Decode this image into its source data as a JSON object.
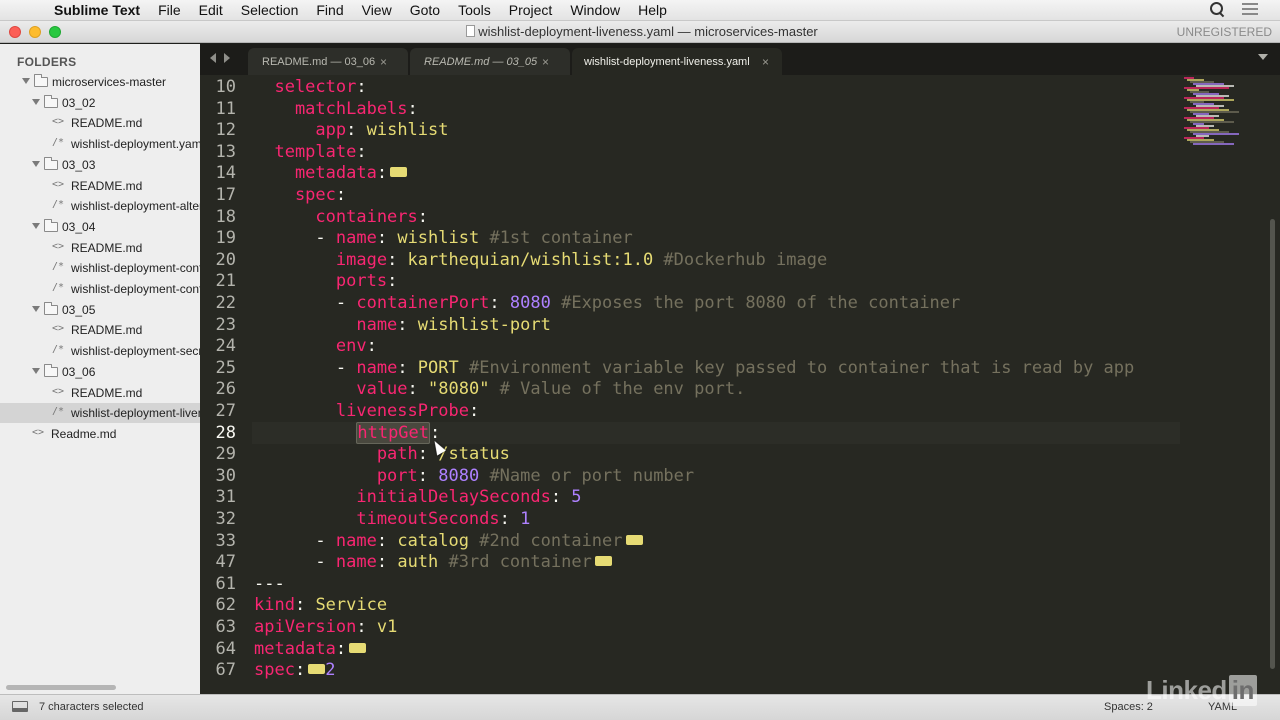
{
  "menubar": {
    "app_name": "Sublime Text",
    "items": [
      "File",
      "Edit",
      "Selection",
      "Find",
      "View",
      "Goto",
      "Tools",
      "Project",
      "Window",
      "Help"
    ]
  },
  "window": {
    "title": "wishlist-deployment-liveness.yaml — microservices-master",
    "registration": "UNREGISTERED"
  },
  "sidebar": {
    "header": "FOLDERS",
    "tree": [
      {
        "label": "microservices-master",
        "kind": "folder",
        "depth": 0
      },
      {
        "label": "03_02",
        "kind": "folder",
        "depth": 1
      },
      {
        "label": "README.md",
        "kind": "file",
        "icon": "<>",
        "depth": 2
      },
      {
        "label": "wishlist-deployment.yaml",
        "kind": "file",
        "icon": "/*",
        "depth": 2
      },
      {
        "label": "03_03",
        "kind": "folder",
        "depth": 1
      },
      {
        "label": "README.md",
        "kind": "file",
        "icon": "<>",
        "depth": 2
      },
      {
        "label": "wishlist-deployment-alternate.yaml",
        "kind": "file",
        "icon": "/*",
        "depth": 2
      },
      {
        "label": "03_04",
        "kind": "folder",
        "depth": 1
      },
      {
        "label": "README.md",
        "kind": "file",
        "icon": "<>",
        "depth": 2
      },
      {
        "label": "wishlist-deployment-configmap.yaml",
        "kind": "file",
        "icon": "/*",
        "depth": 2
      },
      {
        "label": "wishlist-deployment-configmap-advanced.yaml",
        "kind": "file",
        "icon": "/*",
        "depth": 2
      },
      {
        "label": "03_05",
        "kind": "folder",
        "depth": 1
      },
      {
        "label": "README.md",
        "kind": "file",
        "icon": "<>",
        "depth": 2
      },
      {
        "label": "wishlist-deployment-secret.yaml",
        "kind": "file",
        "icon": "/*",
        "depth": 2
      },
      {
        "label": "03_06",
        "kind": "folder",
        "depth": 1
      },
      {
        "label": "README.md",
        "kind": "file",
        "icon": "<>",
        "depth": 2
      },
      {
        "label": "wishlist-deployment-liveness.yaml",
        "kind": "file",
        "icon": "/*",
        "depth": 2,
        "selected": true
      },
      {
        "label": "Readme.md",
        "kind": "file",
        "icon": "<>",
        "depth": 1
      }
    ]
  },
  "tabs": [
    {
      "label": "README.md — 03_06",
      "active": false,
      "italic": false
    },
    {
      "label": "README.md — 03_05",
      "active": false,
      "italic": true
    },
    {
      "label": "wishlist-deployment-liveness.yaml",
      "active": true,
      "italic": false
    }
  ],
  "tab_close_glyph": "×",
  "editor": {
    "current_line": 28,
    "lines": [
      {
        "n": "10",
        "t": [
          [
            "k",
            "  selector"
          ],
          [
            "p",
            ":"
          ]
        ]
      },
      {
        "n": "11",
        "t": [
          [
            "k",
            "    matchLabels"
          ],
          [
            "p",
            ":"
          ]
        ]
      },
      {
        "n": "12",
        "t": [
          [
            "k",
            "      app"
          ],
          [
            "p",
            ": "
          ],
          [
            "s",
            "wishlist"
          ]
        ]
      },
      {
        "n": "13",
        "t": [
          [
            "k",
            "  template"
          ],
          [
            "p",
            ":"
          ]
        ]
      },
      {
        "n": "14",
        "t": [
          [
            "k",
            "    metadata"
          ],
          [
            "p",
            ":"
          ],
          [
            "fold",
            ""
          ]
        ]
      },
      {
        "n": "17",
        "t": [
          [
            "k",
            "    spec"
          ],
          [
            "p",
            ":"
          ]
        ]
      },
      {
        "n": "18",
        "t": [
          [
            "k",
            "      containers"
          ],
          [
            "p",
            ":"
          ]
        ]
      },
      {
        "n": "19",
        "t": [
          [
            "p",
            "      - "
          ],
          [
            "k",
            "name"
          ],
          [
            "p",
            ": "
          ],
          [
            "s",
            "wishlist "
          ],
          [
            "c",
            "#1st container"
          ]
        ]
      },
      {
        "n": "20",
        "t": [
          [
            "k",
            "        image"
          ],
          [
            "p",
            ": "
          ],
          [
            "s",
            "karthequian/wishlist:1.0 "
          ],
          [
            "c",
            "#Dockerhub image"
          ]
        ]
      },
      {
        "n": "21",
        "t": [
          [
            "k",
            "        ports"
          ],
          [
            "p",
            ":"
          ]
        ]
      },
      {
        "n": "22",
        "t": [
          [
            "p",
            "        - "
          ],
          [
            "k",
            "containerPort"
          ],
          [
            "p",
            ": "
          ],
          [
            "n",
            "8080 "
          ],
          [
            "c",
            "#Exposes the port 8080 of the container"
          ]
        ]
      },
      {
        "n": "23",
        "t": [
          [
            "k",
            "          name"
          ],
          [
            "p",
            ": "
          ],
          [
            "s",
            "wishlist-port"
          ]
        ]
      },
      {
        "n": "24",
        "t": [
          [
            "k",
            "        env"
          ],
          [
            "p",
            ":"
          ]
        ]
      },
      {
        "n": "25",
        "t": [
          [
            "p",
            "        - "
          ],
          [
            "k",
            "name"
          ],
          [
            "p",
            ": "
          ],
          [
            "s",
            "PORT "
          ],
          [
            "c",
            "#Environment variable key passed to container that is read by app"
          ]
        ]
      },
      {
        "n": "26",
        "t": [
          [
            "k",
            "          value"
          ],
          [
            "p",
            ": "
          ],
          [
            "s",
            "\"8080\" "
          ],
          [
            "c",
            "# Value of the env port."
          ]
        ]
      },
      {
        "n": "27",
        "t": [
          [
            "k",
            "        livenessProbe"
          ],
          [
            "p",
            ":"
          ]
        ]
      },
      {
        "n": "28",
        "t": [
          [
            "p",
            "          "
          ],
          [
            "sel",
            "httpGet"
          ],
          [
            "p",
            ":"
          ]
        ]
      },
      {
        "n": "29",
        "t": [
          [
            "k",
            "            path"
          ],
          [
            "p",
            ": "
          ],
          [
            "s",
            "/status"
          ]
        ]
      },
      {
        "n": "30",
        "t": [
          [
            "k",
            "            port"
          ],
          [
            "p",
            ": "
          ],
          [
            "n",
            "8080 "
          ],
          [
            "c",
            "#Name or port number"
          ]
        ]
      },
      {
        "n": "31",
        "t": [
          [
            "k",
            "          initialDelaySeconds"
          ],
          [
            "p",
            ": "
          ],
          [
            "n",
            "5"
          ]
        ]
      },
      {
        "n": "32",
        "t": [
          [
            "k",
            "          timeoutSeconds"
          ],
          [
            "p",
            ": "
          ],
          [
            "n",
            "1"
          ]
        ]
      },
      {
        "n": "33",
        "t": [
          [
            "p",
            "      - "
          ],
          [
            "k",
            "name"
          ],
          [
            "p",
            ": "
          ],
          [
            "s",
            "catalog "
          ],
          [
            "c",
            "#2nd container"
          ],
          [
            "fold",
            ""
          ]
        ]
      },
      {
        "n": "47",
        "t": [
          [
            "p",
            "      - "
          ],
          [
            "k",
            "name"
          ],
          [
            "p",
            ": "
          ],
          [
            "s",
            "auth "
          ],
          [
            "c",
            "#3rd container"
          ],
          [
            "fold",
            ""
          ]
        ]
      },
      {
        "n": "61",
        "t": [
          [
            "p",
            "---"
          ]
        ]
      },
      {
        "n": "62",
        "t": [
          [
            "k",
            "kind"
          ],
          [
            "p",
            ": "
          ],
          [
            "s",
            "Service"
          ]
        ]
      },
      {
        "n": "63",
        "t": [
          [
            "k",
            "apiVersion"
          ],
          [
            "p",
            ": "
          ],
          [
            "s",
            "v1"
          ]
        ]
      },
      {
        "n": "64",
        "t": [
          [
            "k",
            "metadata"
          ],
          [
            "p",
            ":"
          ],
          [
            "fold",
            ""
          ]
        ]
      },
      {
        "n": "67",
        "t": [
          [
            "k",
            "spec"
          ],
          [
            "p",
            ":"
          ],
          [
            "fold",
            ""
          ],
          [
            "n",
            "2"
          ]
        ]
      }
    ]
  },
  "statusbar": {
    "selection": "7 characters selected",
    "indentation": "Spaces: 2",
    "syntax": "YAML"
  },
  "watermark": {
    "text": "Linked",
    "box": "in"
  },
  "colors": {
    "editor_bg": "#272822",
    "keyword": "#f92672",
    "string": "#e6db74",
    "number": "#ae81ff",
    "comment": "#75715e"
  }
}
